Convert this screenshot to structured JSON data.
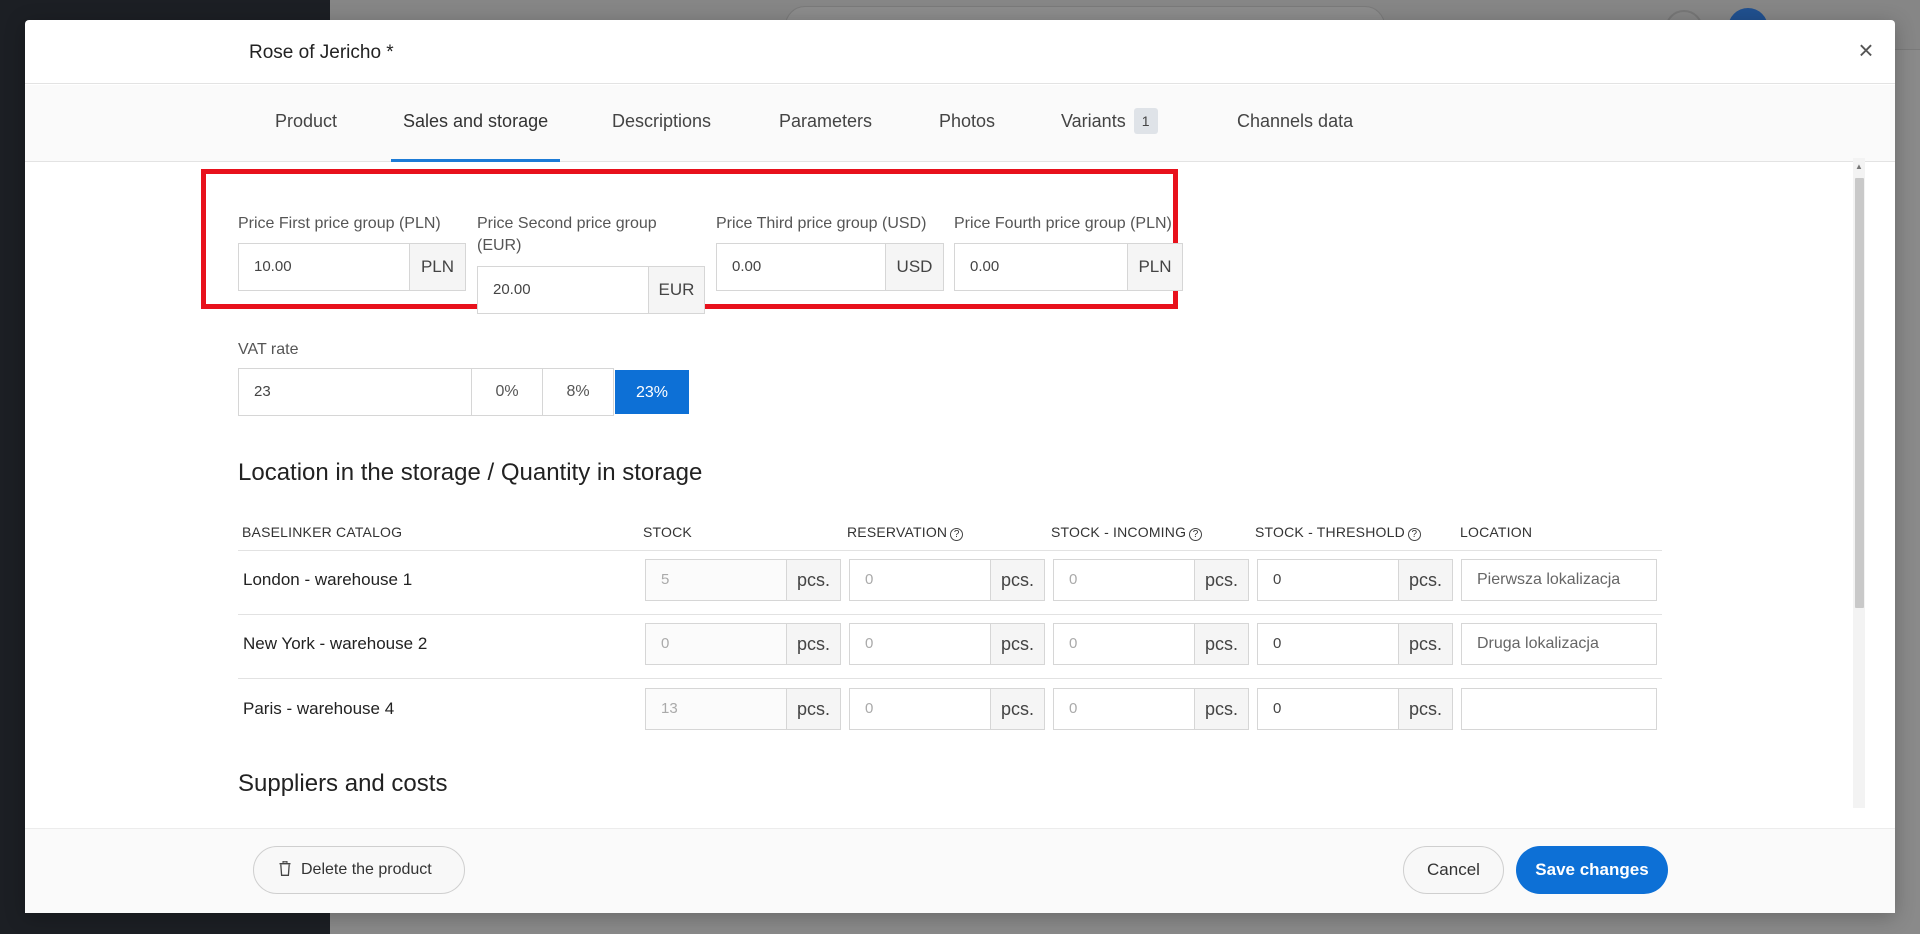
{
  "modal": {
    "title": "Rose of Jericho *",
    "close_label": "×"
  },
  "tabs": [
    {
      "label": "Product"
    },
    {
      "label": "Sales and storage",
      "active": true
    },
    {
      "label": "Descriptions"
    },
    {
      "label": "Parameters"
    },
    {
      "label": "Photos"
    },
    {
      "label": "Variants",
      "badge": "1"
    },
    {
      "label": "Channels data"
    }
  ],
  "prices": [
    {
      "label": "Price First price group (PLN)",
      "value": "10.00",
      "currency": "PLN"
    },
    {
      "label_line1": "Price Second price group",
      "label_line2": "(EUR)",
      "value": "20.00",
      "currency": "EUR"
    },
    {
      "label": "Price Third price group (USD)",
      "value": "0.00",
      "currency": "USD"
    },
    {
      "label": "Price Fourth price group (PLN)",
      "value": "0.00",
      "currency": "PLN"
    }
  ],
  "vat": {
    "label": "VAT rate",
    "value": "23",
    "options": [
      "0%",
      "8%",
      "23%"
    ],
    "selected": "23%"
  },
  "storage": {
    "title": "Location in the storage / Quantity in storage",
    "columns": [
      "BASELINKER CATALOG",
      "STOCK",
      "RESERVATION",
      "STOCK - INCOMING",
      "STOCK - THRESHOLD",
      "LOCATION"
    ],
    "help_icon": "?",
    "unit": "pcs.",
    "rows": [
      {
        "name": "London - warehouse 1",
        "stock": "5",
        "reservation": "0",
        "incoming": "0",
        "threshold": "0",
        "location": "Pierwsza lokalizacja"
      },
      {
        "name": "New York - warehouse 2",
        "stock": "0",
        "reservation": "0",
        "incoming": "0",
        "threshold": "0",
        "location": "Druga lokalizacja"
      },
      {
        "name": "Paris - warehouse 4",
        "stock": "13",
        "reservation": "0",
        "incoming": "0",
        "threshold": "0",
        "location": ""
      }
    ]
  },
  "suppliers": {
    "title": "Suppliers and costs"
  },
  "footer": {
    "delete_label": "Delete the product",
    "cancel_label": "Cancel",
    "save_label": "Save changes"
  },
  "colors": {
    "accent": "#0d70d6",
    "highlight": "#e8111c"
  }
}
